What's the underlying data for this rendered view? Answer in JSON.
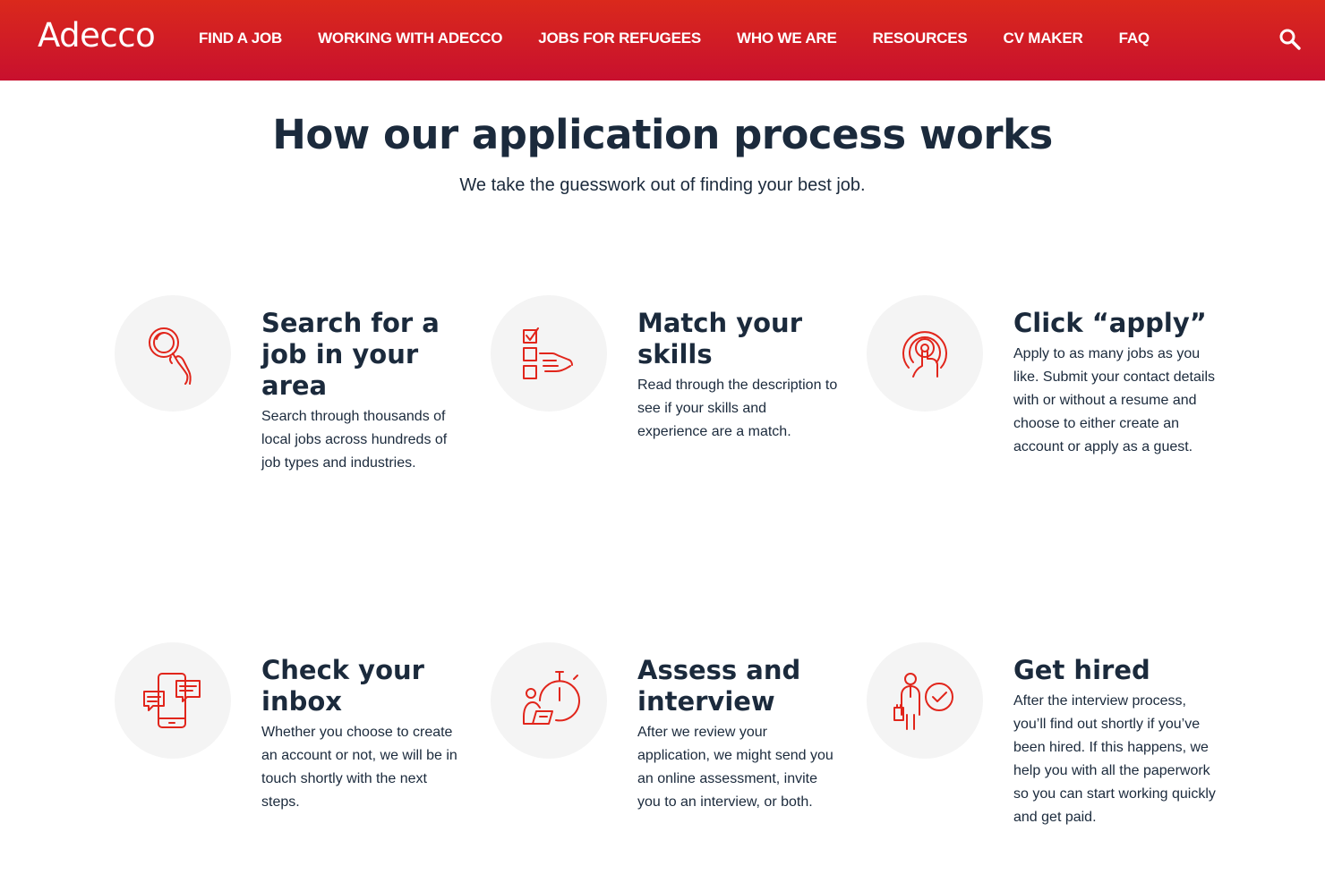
{
  "header": {
    "logo": "Adecco",
    "nav": [
      {
        "label": "FIND A JOB"
      },
      {
        "label": "WORKING WITH ADECCO"
      },
      {
        "label": "JOBS FOR REFUGEES"
      },
      {
        "label": "WHO WE ARE"
      },
      {
        "label": "RESOURCES"
      },
      {
        "label": "CV MAKER"
      },
      {
        "label": "FAQ"
      }
    ],
    "search_icon": "search-icon"
  },
  "main": {
    "title": "How our application process works",
    "subtitle": "We take the guesswork out of finding your best job."
  },
  "steps": [
    {
      "icon": "magnifier-hand-icon",
      "title": "Search for a job in your area",
      "body": "Search through thousands of local jobs across hundreds of job types and industries."
    },
    {
      "icon": "checklist-hand-icon",
      "title": "Match your skills",
      "body": "Read through the description to see if your skills and experience are a match."
    },
    {
      "icon": "target-tap-icon",
      "title": "Click “apply”",
      "body": "Apply to as many jobs as you like. Submit your contact details with or without a resume and choose to either create an account or apply as a guest."
    },
    {
      "icon": "phone-chat-icon",
      "title": "Check your inbox",
      "body": "Whether you choose to create an account or not, we will be in touch shortly with the next steps."
    },
    {
      "icon": "stopwatch-laptop-icon",
      "title": "Assess and interview",
      "body": "After we review your application, we might send you an online assessment, invite you to an interview, or both."
    },
    {
      "icon": "person-check-icon",
      "title": "Get hired",
      "body": "After the interview process, you’ll find out shortly if you’ve been hired. If this happens, we help you with all the paperwork so you can start working quickly and get paid."
    }
  ],
  "colors": {
    "brand_red": "#da291c",
    "icon_red": "#e1251b",
    "text_navy": "#1b2a3c",
    "circle_bg": "#f4f4f4"
  }
}
